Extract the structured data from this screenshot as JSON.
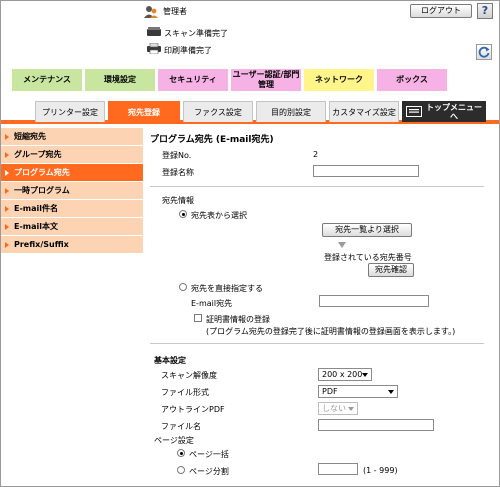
{
  "header": {
    "user_label": "管理者",
    "logout_label": "ログアウト",
    "help_label": "?",
    "scan_status": "スキャン準備完了",
    "print_status": "印刷準備完了"
  },
  "main_tabs": [
    {
      "label": "メンテナンス",
      "color": "#c8e6a0"
    },
    {
      "label": "環境設定",
      "color": "#c8e6a0"
    },
    {
      "label": "セキュリティ",
      "color": "#f6b2e4"
    },
    {
      "label": "ユーザー認証/部門管理",
      "color": "#f6b2e4"
    },
    {
      "label": "ネットワーク",
      "color": "#fff58a"
    },
    {
      "label": "ボックス",
      "color": "#f6b2e4"
    }
  ],
  "sub_tabs": [
    {
      "label": "プリンター設定"
    },
    {
      "label": "宛先登録"
    },
    {
      "label": "ファクス設定"
    },
    {
      "label": "目的別設定"
    },
    {
      "label": "カスタマイズ設定"
    },
    {
      "label": "トップメニューへ"
    }
  ],
  "sidebar": {
    "items": [
      {
        "label": "短縮宛先"
      },
      {
        "label": "グループ宛先"
      },
      {
        "label": "プログラム宛先"
      },
      {
        "label": "一時プログラム"
      },
      {
        "label": "E-mail件名"
      },
      {
        "label": "E-mail本文"
      },
      {
        "label": "Prefix/Suffix"
      }
    ]
  },
  "content": {
    "title": "プログラム宛先 (E-mail宛先)",
    "reg_no_label": "登録No.",
    "reg_no_value": "2",
    "reg_name_label": "登録名称",
    "reg_name_value": "",
    "dest_info_label": "宛先情報",
    "radio_select_list": "宛先表から選択",
    "select_from_list_button": "宛先一覧より選択",
    "registered_dest_no": "登録されている宛先番号",
    "confirm_dest_button": "宛先確認",
    "radio_direct": "宛先を直接指定する",
    "email_label": "E-mail宛先",
    "email_value": "",
    "cert_checkbox_label": "証明書情報の登録",
    "cert_note": "(プログラム宛先の登録完了後に証明書情報の登録画面を表示します。)",
    "basic_settings": "基本設定",
    "scan_res_label": "スキャン解像度",
    "scan_res_value": "200 x 200",
    "file_format_label": "ファイル形式",
    "file_format_value": "PDF",
    "outline_pdf_label": "アウトラインPDF",
    "outline_pdf_value": "しない",
    "file_name_label": "ファイル名",
    "file_name_value": "",
    "page_setting_label": "ページ設定",
    "page_batch_label": "ページ一括",
    "page_split_label": "ページ分割",
    "page_split_value": "",
    "page_split_range": "(1 - 999)"
  },
  "colors": {
    "accent": "#ff6a1e",
    "sidebar_bg": "#fcd3b3",
    "top_menu_bg": "#2c2c2c"
  }
}
